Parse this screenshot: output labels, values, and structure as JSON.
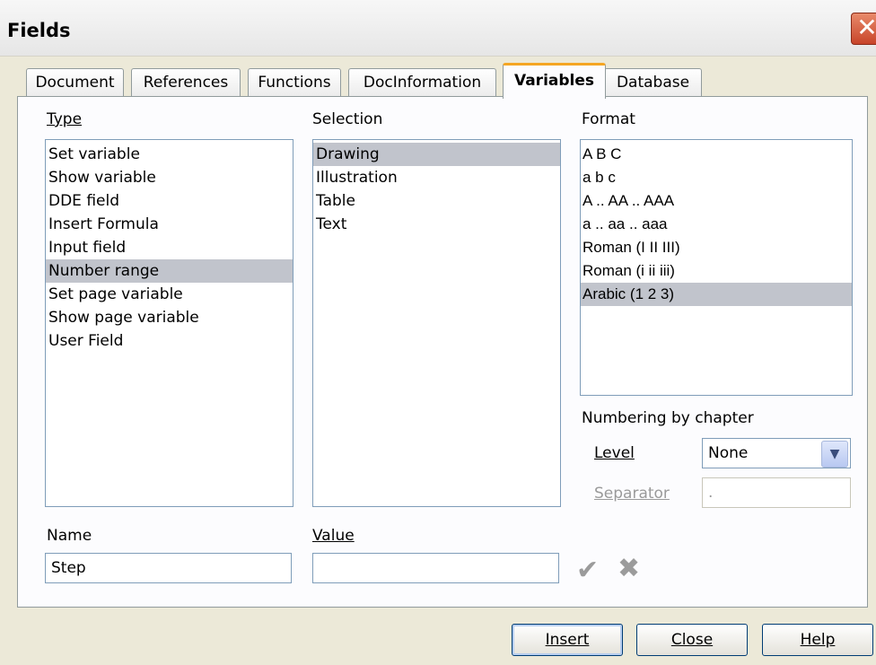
{
  "window": {
    "title": "Fields",
    "close_glyph": "✕"
  },
  "tabs": [
    "Document",
    "References",
    "Functions",
    "DocInformation",
    "Variables",
    "Database"
  ],
  "type_label": "Type",
  "selection_label": "Selection",
  "format_label": "Format",
  "type_items": [
    "Set variable",
    "Show variable",
    "DDE field",
    "Insert Formula",
    "Input field",
    "Number range",
    "Set page variable",
    "Show page variable",
    "User Field"
  ],
  "type_selected": "Number range",
  "selection_items": [
    "Drawing",
    "Illustration",
    "Table",
    "Text"
  ],
  "selection_selected": "Drawing",
  "format_items": [
    "A B C",
    "a b c",
    "A .. AA .. AAA",
    "a .. aa .. aaa",
    "Roman (I II III)",
    "Roman (i ii iii)",
    "Arabic (1 2 3)"
  ],
  "format_selected": "Arabic (1 2 3)",
  "numbering": {
    "title": "Numbering by chapter",
    "level_label": "Level",
    "level_value": "None",
    "separator_label": "Separator",
    "separator_value": "."
  },
  "name_label": "Name",
  "name_value": "Step",
  "value_label": "Value",
  "value_value": "",
  "icons": {
    "apply": "checkmark-icon",
    "clear": "x-icon",
    "dropdown": "chevron-down-icon"
  },
  "buttons": {
    "insert": "Insert",
    "close": "Close",
    "help": "Help"
  }
}
